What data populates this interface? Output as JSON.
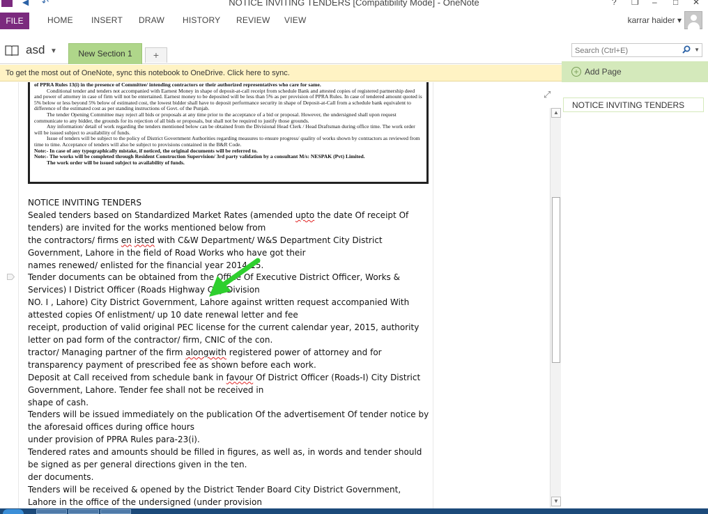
{
  "window": {
    "title": "NOTICE INVITING TENDERS [Compatibility Mode] - OneNote",
    "controls": {
      "help": "?",
      "restore": "❐",
      "minimize": "–",
      "maximize": "□",
      "close": "✕"
    }
  },
  "ribbon": {
    "file": "FILE",
    "tabs": [
      "HOME",
      "INSERT",
      "DRAW",
      "HISTORY",
      "REVIEW",
      "VIEW"
    ],
    "user": "karrar haider ▾"
  },
  "notebook": {
    "name": "asd",
    "dropdown": "▼",
    "section": "New Section 1",
    "add_section": "+"
  },
  "search": {
    "placeholder": "Search (Ctrl+E)"
  },
  "infobar": {
    "text": "To get the most out of OneNote, sync this notebook to OneDrive. Click here to sync."
  },
  "pages": {
    "add_page": "Add Page",
    "items": [
      "NOTICE INVITING TENDERS"
    ]
  },
  "scan_lines": [
    "of PPRA Rules 13(i) in the presence of Committee/ intending contractors or their authorized representatives who care for same.",
    "Conditional tender and tenders not accompanied with Earnest Money in shape of deposit-at-call receipt from schedule Bank and attested copies of registered partnership deed and power of attorney in case of firm will not be entertained. Earnest money to be deposited will be less than 5% as per provision of PPRA Rules. In case of tendered amount quoted is 5% below or less beyond 5% below of estimated cost, the lowest bidder shall have to deposit performance security in shape of Deposit-at-Call from a schedule bank equivalent to difference of the estimated cost as per standing instructions of Govt. of the Punjab.",
    "The tender Opening Committee may reject all bids or proposals at any time prior to the acceptance of a bid or proposal. However, the undersigned shall upon request communicate to any bidder, the grounds for its rejection of all bids or proposals, but shall not be required to justify those grounds.",
    "Any information/ detail of work regarding the tenders mentioned below can be obtained from the Divisional Head Clerk / Head Draftsman during office time. The work order will be issued subject to availability of funds.",
    "Issue of tenders will be subject to the policy of District Government Authorities regarding measures to ensure progress/ quality of works shown by contractors as reviewed from time to time. Acceptance of tenders will also be subject to provisions contained in the B&R Code.",
    "Note:- In case of any typographically mistake, if noticed, the original documents will be referred to.",
    "Note:- The works will be completed through Resident Construction Supervision/ 3rd party validation by a consultant M/s: NESPAK (Pvt) Limited.",
    "The work order will be issued subject to availability of funds."
  ],
  "notice_lines": [
    "NOTICE INVITING TENDERS",
    "Sealed tenders based on Standardized Market Rates (amended upto the date Of receipt Of",
    "tenders) are invited for the works mentioned below from",
    "the contractors/ firms en isted with C&W Department/ W&S Department City District",
    "Government, Lahore in the field of Road Works who have got their",
    "names renewed/ enlisted for the financial year 2014-15.",
    "Tender documents can be obtained from the Office Of Executive District Officer, Works &",
    "Services) I District Officer (Roads Highway City Division",
    "NO. I , Lahore) City District Government, Lahore against written request accompanied With",
    "attested copies Of enlistment/ up 10 date renewal letter and fee",
    "receipt, production of valid original PEC license for the current calendar year, 2015, authority",
    "letter on pad form of the contractor/ firm, CNIC of the con.",
    "tractor/ Managing partner of the firm alongwith registered power of attorney and for",
    "transparency payment of prescribed fee as shown before each work.",
    "Deposit at Call received from schedule bank in favour Of District Officer (Roads-I) City District",
    "Government, Lahore. Tender fee shall not be received in",
    "shape of cash.",
    "Tenders will be issued immediately on the publication Of the advertisement Of tender notice by",
    "the aforesaid offices during office hours",
    "under provision of PPRA Rules para-23(i).",
    "Tendered rates and amounts should be filled in figures, as well as, in words and tender should",
    "be signed as per general directions given in the ten.",
    "der documents.",
    "Tenders will be received & opened by the District Tender Board City District Government,",
    "Lahore in the office of the undersigned (under provision"
  ],
  "colors": {
    "file_tab": "#7b2a7e",
    "section_tab": "#afd68a",
    "infobar": "#fff3c4",
    "pane": "#d4e9bb",
    "arrow": "#2fcf2f"
  },
  "icons": {
    "search": "⚲",
    "expand": "⤢",
    "scroll_up": "▲",
    "scroll_down": "▼"
  }
}
